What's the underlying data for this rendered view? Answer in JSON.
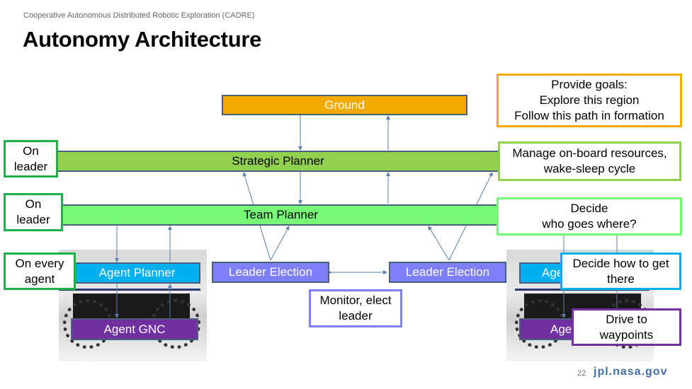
{
  "header": {
    "subtitle": "Cooperative Autonomous Distributed Robotic Exploration (CADRE)",
    "title": "Autonomy Architecture"
  },
  "blocks": {
    "ground": "Ground",
    "strategic_planner": "Strategic Planner",
    "team_planner": "Team Planner",
    "agent_planner": "Agent Planner",
    "agent_gnc": "Agent GNC",
    "agent_planner_right": "Age",
    "agent_gnc_right": "Age",
    "leader_election_left": "Leader Election",
    "leader_election_right": "Leader Election"
  },
  "annotations": {
    "goals": "Provide goals:\nExplore this region\nFollow this path in formation",
    "manage": "Manage on-board resources,\nwake-sleep cycle",
    "decide": "Decide\nwho goes where?",
    "how": "Decide how to get\nthere",
    "drive": "Drive to\nwaypoints",
    "monitor": "Monitor, elect\nleader",
    "on_leader_1": "On\nleader",
    "on_leader_2": "On\nleader",
    "on_every_agent": "On every\nagent"
  },
  "colors": {
    "ground": "#f2a900",
    "strategic": "#92d050",
    "team": "#77f977",
    "agent_planner": "#00b0f0",
    "agent_gnc": "#7030a0",
    "leader_election": "#7f7ff9",
    "location_label": "#1fb04a",
    "arrow": "#5b7ea6"
  },
  "footer": {
    "page_number": "22",
    "url": "jpl.nasa.gov"
  }
}
